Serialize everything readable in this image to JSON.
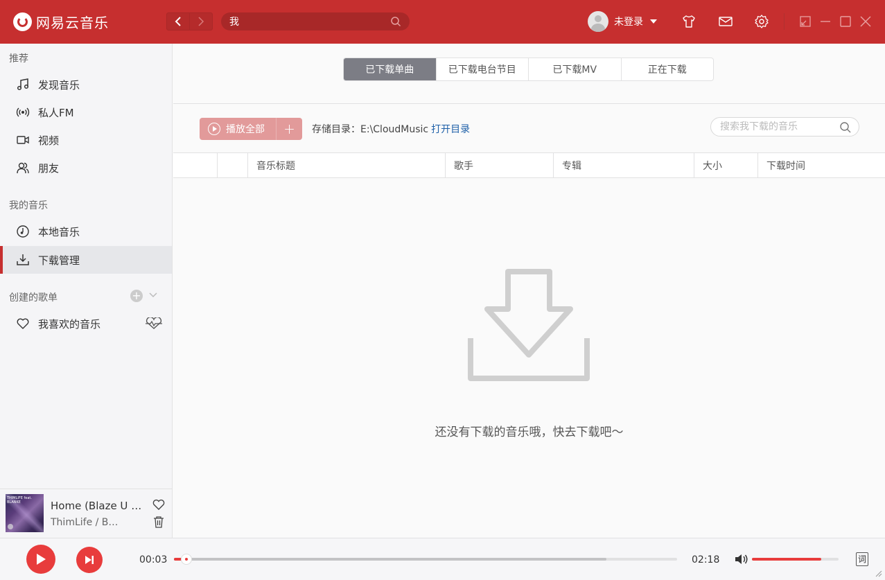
{
  "app": {
    "title": "网易云音乐"
  },
  "search": {
    "value": "我"
  },
  "user": {
    "name": "未登录"
  },
  "sidebar": {
    "sections": {
      "recommend": "推荐",
      "my_music": "我的音乐",
      "playlists": "创建的歌单"
    },
    "recommend_items": [
      {
        "label": "发现音乐",
        "icon": "music-note-icon"
      },
      {
        "label": "私人FM",
        "icon": "radio-icon"
      },
      {
        "label": "视频",
        "icon": "video-icon"
      },
      {
        "label": "朋友",
        "icon": "friends-icon"
      }
    ],
    "my_music_items": [
      {
        "label": "本地音乐",
        "icon": "local-music-icon"
      },
      {
        "label": "下载管理",
        "icon": "download-icon",
        "active": true
      }
    ],
    "playlist_items": [
      {
        "label": "我喜欢的音乐",
        "icon": "heart-icon"
      }
    ]
  },
  "now_playing": {
    "title": "Home (Blaze U Re...",
    "artist": "ThimLife / Bl...",
    "cover_text": "THIMLIFE feat. BLANKE"
  },
  "downloads": {
    "tabs": [
      {
        "label": "已下载单曲",
        "active": true
      },
      {
        "label": "已下载电台节目",
        "active": false
      },
      {
        "label": "已下载MV",
        "active": false
      },
      {
        "label": "正在下载",
        "active": false
      }
    ],
    "play_all_label": "播放全部",
    "add_label": "+",
    "storage_label": "存储目录：",
    "storage_path": "E:\\CloudMusic",
    "open_dir_label": "打开目录",
    "search_placeholder": "搜索我下载的音乐",
    "columns": [
      "音乐标题",
      "歌手",
      "专辑",
      "大小",
      "下载时间"
    ],
    "empty_text": "还没有下载的音乐哦，快去下载吧～"
  },
  "player": {
    "current_time": "00:03",
    "total_time": "02:18",
    "buffered_fraction": 0.86,
    "played_fraction": 0.025,
    "volume_fraction": 0.8,
    "lyric_label": "词"
  },
  "colors": {
    "brand": "#c62f2f",
    "accent": "#e83c3c"
  }
}
